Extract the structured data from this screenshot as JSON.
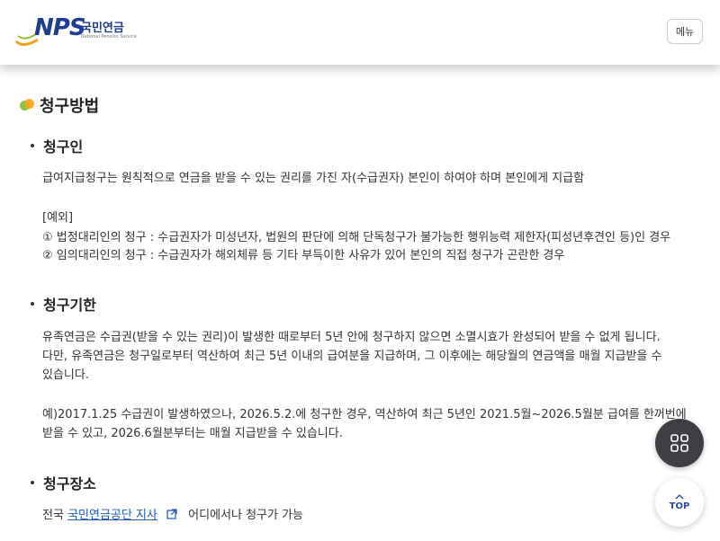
{
  "header": {
    "logo_text": "NPS",
    "logo_korean": "국민연금",
    "logo_english": "National Pension Service",
    "menu_label": "메뉴"
  },
  "section": {
    "title": "청구방법"
  },
  "claimant": {
    "heading": "청구인",
    "line1": "급여지급청구는 원칙적으로 연금을 받을 수 있는 권리를 가진 자(수급권자) 본인이 하여야 하며 본인에게 지급함",
    "exception_label": "[예외]",
    "exception1": "① 법정대리인의 청구 : 수급권자가 미성년자, 법원의 판단에 의해 단독청구가 불가능한 행위능력 제한자(피성년후견인 등)인 경우",
    "exception2": "② 임의대리인의 청구 : 수급권자가 해외체류 등 기타 부득이한 사유가 있어 본인의 직접 청구가 곤란한 경우"
  },
  "deadline": {
    "heading": "청구기한",
    "line1": "유족연금은 수급권(받을 수 있는 권리)이 발생한 때로부터 5년 안에 청구하지 않으면 소멸시효가 완성되어 받을 수 없게 됩니다.",
    "line2": "다만, 유족연금은 청구일로부터 역산하여 최근 5년 이내의 급여분을 지급하며, 그 이후에는 해당월의 연금액을 매월 지급받을 수",
    "line3": "있습니다.",
    "example1": "예)2017.1.25 수급권이 발생하였으나, 2026.5.2.에 청구한 경우, 역산하여 최근 5년인 2021.5월~2026.5월분 급여를 한꺼번에",
    "example2": "받을 수 있고, 2026.6월분부터는 매월 지급받을 수 있습니다."
  },
  "place": {
    "heading": "청구장소",
    "prefix": "전국",
    "link_text": "국민연금공단 지사",
    "suffix": "어디에서나 청구가 가능"
  },
  "floating": {
    "top_label": "TOP"
  },
  "colors": {
    "brand_blue": "#1e3d8f",
    "link_blue": "#1f5bb5",
    "float_dark": "#3d3f44"
  }
}
